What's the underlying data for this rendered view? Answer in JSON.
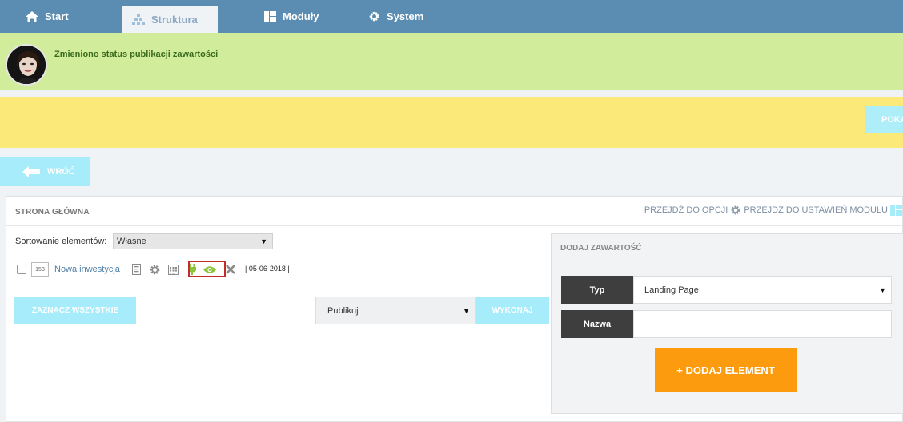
{
  "nav": {
    "tabs": [
      {
        "label": "Start",
        "icon": "home-icon"
      },
      {
        "label": "Struktura",
        "icon": "structure-icon"
      },
      {
        "label": "Moduły",
        "icon": "modules-icon"
      },
      {
        "label": "System",
        "icon": "gear-icon"
      }
    ],
    "active_tab": "Struktura"
  },
  "notification": {
    "message": "Zmieniono status publikacji zawartości",
    "color": "#d1ec9b"
  },
  "yellow_notice": {
    "button_label": "POKA"
  },
  "back_button": {
    "label": "WRÓĆ"
  },
  "panel": {
    "title": "STRONA GŁÓWNA",
    "link_options": "PRZEJDŹ DO OPCJI",
    "link_module_settings": "PRZEJDŹ DO USTAWIEŃ MODUŁU",
    "sort_label": "Sortowanie elementów:",
    "sort_value": "Własne",
    "items": [
      {
        "id": "153",
        "name": "Nowa inwestycja",
        "date": "| 05-06-2018 |"
      }
    ],
    "select_all_label": "ZAZNACZ WSZYSTKIE",
    "action_value": "Publikuj",
    "execute_label": "WYKONAJ"
  },
  "add_content": {
    "title": "DODAJ ZAWARTOŚĆ",
    "type_label": "Typ",
    "type_value": "Landing Page",
    "name_label": "Nazwa",
    "name_value": "",
    "add_button_label": "+ DODAJ ELEMENT"
  },
  "colors": {
    "nav_bg": "#5b8db3",
    "yellow_notice": "#fbe97a",
    "light_button": "#a6ecfa",
    "add_button": "#fd9b0e",
    "highlight_border": "#c42b2b"
  }
}
